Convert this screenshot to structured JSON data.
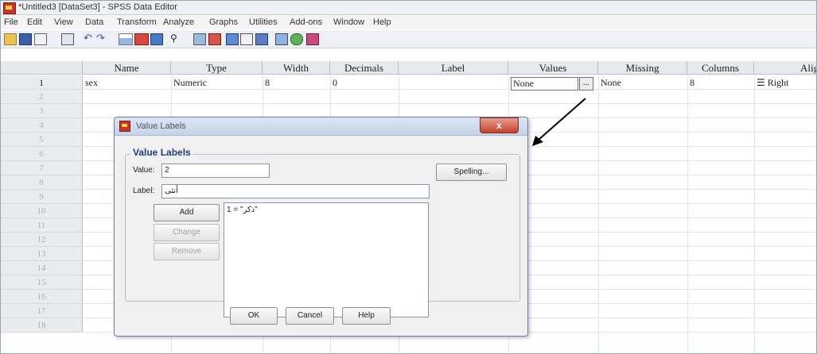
{
  "window": {
    "title": "*Untitled3 [DataSet3] - SPSS Data Editor"
  },
  "menu": [
    "File",
    "Edit",
    "View",
    "Data",
    "Transform",
    "Analyze",
    "Graphs",
    "Utilities",
    "Add-ons",
    "Window",
    "Help"
  ],
  "grid": {
    "columns": [
      "Name",
      "Type",
      "Width",
      "Decimals",
      "Label",
      "Values",
      "Missing",
      "Columns",
      "Align"
    ],
    "rows": [
      "1",
      "2",
      "3",
      "4",
      "5",
      "6",
      "7",
      "8",
      "9",
      "10",
      "11",
      "12",
      "13",
      "14",
      "15",
      "16",
      "17",
      "18"
    ],
    "row1": {
      "name": "sex",
      "type": "Numeric",
      "width": "8",
      "decimals": "0",
      "values": "None",
      "ellipsis": "...",
      "missing": "None",
      "columns": "8",
      "align": "Right"
    }
  },
  "dialog": {
    "title": "Value Labels",
    "close": "x",
    "group_label": "Value Labels",
    "value_label": "Value:",
    "value": "2",
    "label_label": "Label:",
    "label_value": "أنثى",
    "spelling": "Spelling...",
    "add": "Add",
    "change": "Change",
    "remove": "Remove",
    "list": [
      "1 = \"ذكر\""
    ],
    "ok": "OK",
    "cancel": "Cancel",
    "help": "Help"
  },
  "colors": {
    "accent": "#1e3d7a",
    "close": "#c8432f"
  }
}
